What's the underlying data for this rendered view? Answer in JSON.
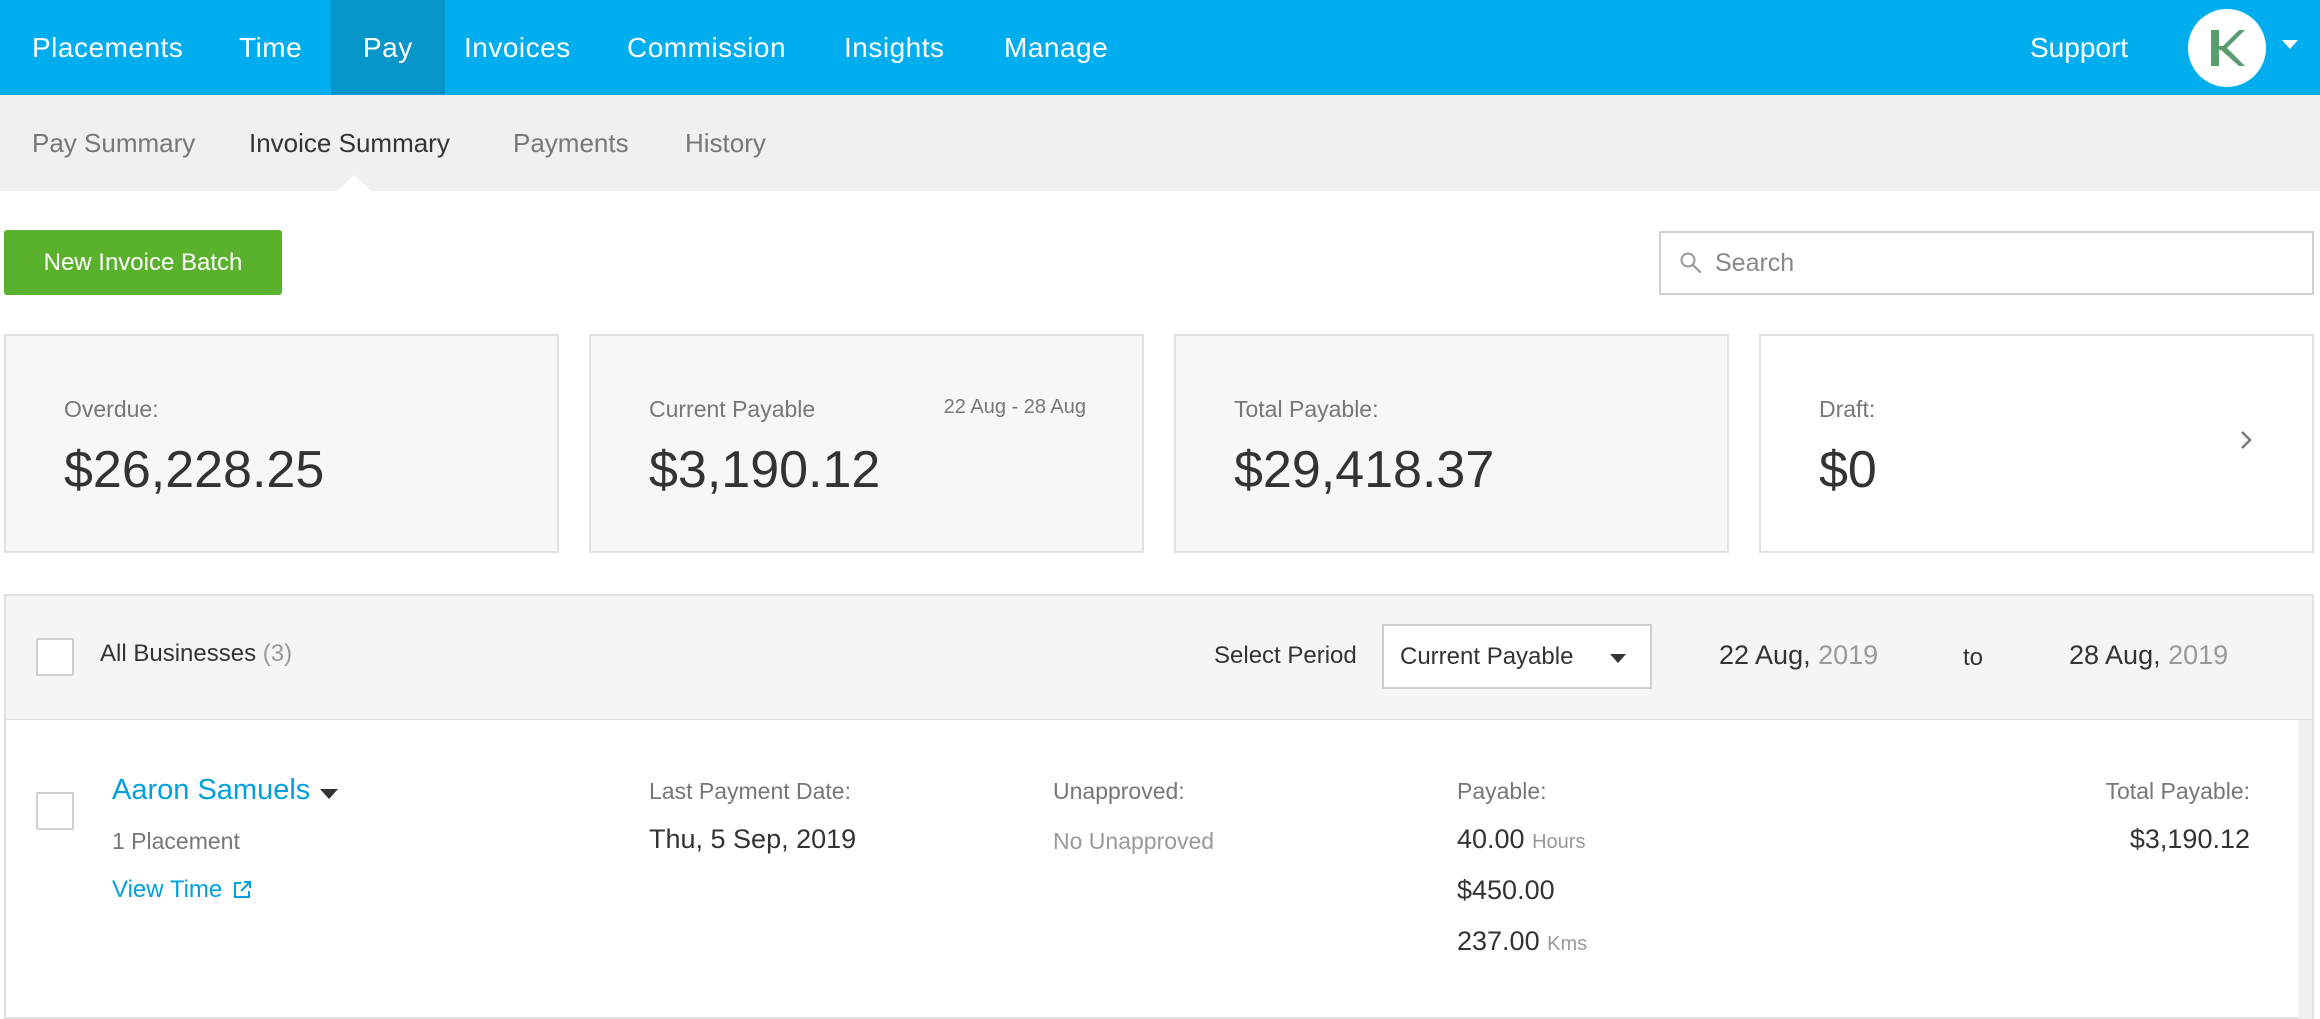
{
  "topnav": {
    "items": [
      {
        "label": "Placements"
      },
      {
        "label": "Time"
      },
      {
        "label": "Pay"
      },
      {
        "label": "Invoices"
      },
      {
        "label": "Commission"
      },
      {
        "label": "Insights"
      },
      {
        "label": "Manage"
      }
    ],
    "active": "Pay",
    "support_label": "Support",
    "avatar_icon": "company-logo-icon"
  },
  "subnav": {
    "items": [
      {
        "label": "Pay Summary"
      },
      {
        "label": "Invoice Summary"
      },
      {
        "label": "Payments"
      },
      {
        "label": "History"
      }
    ],
    "active": "Invoice Summary"
  },
  "toolbar": {
    "new_batch_label": "New Invoice Batch",
    "search_placeholder": "Search"
  },
  "cards": [
    {
      "label": "Overdue:",
      "value": "$26,228.25"
    },
    {
      "label": "Current Payable",
      "value": "$3,190.12",
      "range": "22 Aug - 28 Aug"
    },
    {
      "label": "Total Payable:",
      "value": "$29,418.37"
    },
    {
      "label": "Draft:",
      "value": "$0"
    }
  ],
  "filter": {
    "all_label": "All Businesses",
    "all_count": "(3)",
    "period_label": "Select Period",
    "period_value": "Current Payable",
    "from_day": "22 Aug,",
    "from_year": "2019",
    "to_label": "to",
    "to_day": "28 Aug,",
    "to_year": "2019"
  },
  "rows": [
    {
      "name": "Aaron Samuels",
      "placements": "1 Placement",
      "view_time": "View Time",
      "last_payment_label": "Last Payment Date:",
      "last_payment_value": "Thu, 5 Sep, 2019",
      "unapproved_label": "Unapproved:",
      "unapproved_value": "No Unapproved",
      "payable_label": "Payable:",
      "payable_hours": "40.00",
      "payable_hours_unit": "Hours",
      "payable_amount": "$450.00",
      "payable_kms": "237.00",
      "payable_kms_unit": "Kms",
      "total_label": "Total Payable:",
      "total_value": "$3,190.12"
    }
  ],
  "colors": {
    "topnav_bg": "#00aeef",
    "topnav_active": "#0895c9",
    "primary_button": "#5ab12c",
    "link": "#00a0e0"
  }
}
